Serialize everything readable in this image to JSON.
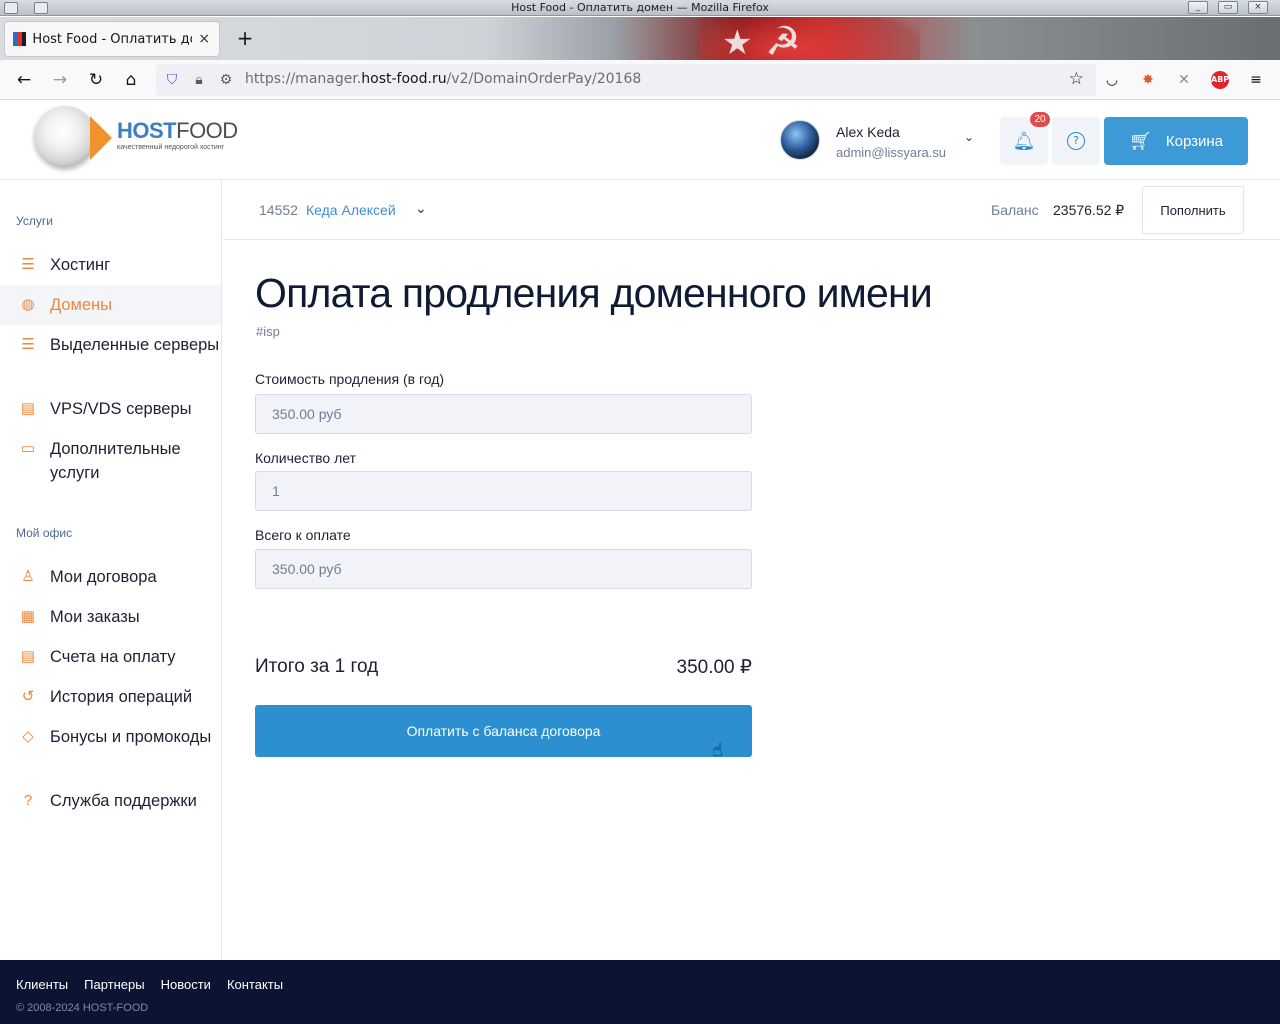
{
  "window": {
    "title": "Host Food - Оплатить домен — Mozilla Firefox"
  },
  "browser": {
    "tab_title": "Host Food - Оплатить домен",
    "url_prefix": "https://manager.",
    "url_domain": "host-food.ru",
    "url_path": "/v2/DomainOrderPay/20168",
    "new_tab_icon": "plus-icon",
    "extensions": [
      "pocket-icon",
      "extension-fox-icon",
      "extension-tools-icon",
      "adblock-plus-icon",
      "hamburger-menu-icon"
    ],
    "abp_label": "ABP"
  },
  "header": {
    "logo_host": "HOST",
    "logo_food": "FOOD",
    "logo_tagline": "качественный недорогой хостинг",
    "user_name": "Alex Keda",
    "user_email": "admin@lissyara.su",
    "notifications_count": "20",
    "cart_label": "Корзина",
    "colors": {
      "accent": "#3d9ad6",
      "brand_orange": "#f0853d"
    }
  },
  "sidebar": {
    "section_services": "Услуги",
    "services": [
      {
        "label": "Хостинг",
        "icon": "server-stack-icon",
        "active": false
      },
      {
        "label": "Домены",
        "icon": "globe-icon",
        "active": true
      },
      {
        "label": "Выделенные серверы",
        "icon": "server-icon",
        "active": false
      },
      {
        "label": "VPS/VDS серверы",
        "icon": "vps-icon",
        "active": false
      },
      {
        "label": "Дополнительные услуги",
        "icon": "addon-icon",
        "active": false
      }
    ],
    "section_office": "Мой офис",
    "office": [
      {
        "label": "Мои договора",
        "icon": "users-icon"
      },
      {
        "label": "Мои заказы",
        "icon": "orders-icon"
      },
      {
        "label": "Счета на оплату",
        "icon": "invoice-icon"
      },
      {
        "label": "История операций",
        "icon": "history-icon"
      },
      {
        "label": "Бонусы и промокоды",
        "icon": "tag-icon"
      },
      {
        "label": "Служба поддержки",
        "icon": "help-icon"
      }
    ]
  },
  "contract": {
    "id": "14552",
    "name": "Кеда Алексей",
    "balance_label": "Баланс",
    "balance_value": "23576.52 ₽",
    "topup_label": "Пополнить"
  },
  "main": {
    "title": "Оплата продления доменного имени",
    "tag": "#isp",
    "fields": [
      {
        "label": "Стоимость продления (в год)",
        "value": "350.00 руб"
      },
      {
        "label": "Количество лет",
        "value": "1"
      },
      {
        "label": "Всего к оплате",
        "value": "350.00 руб"
      }
    ],
    "total_label": "Итого за 1 год",
    "total_value": "350.00 ₽",
    "pay_button": "Оплатить с баланса договора"
  },
  "footer": {
    "links": [
      "Клиенты",
      "Партнеры",
      "Новости",
      "Контакты"
    ],
    "copyright": "© 2008-2024 HOST-FOOD"
  }
}
